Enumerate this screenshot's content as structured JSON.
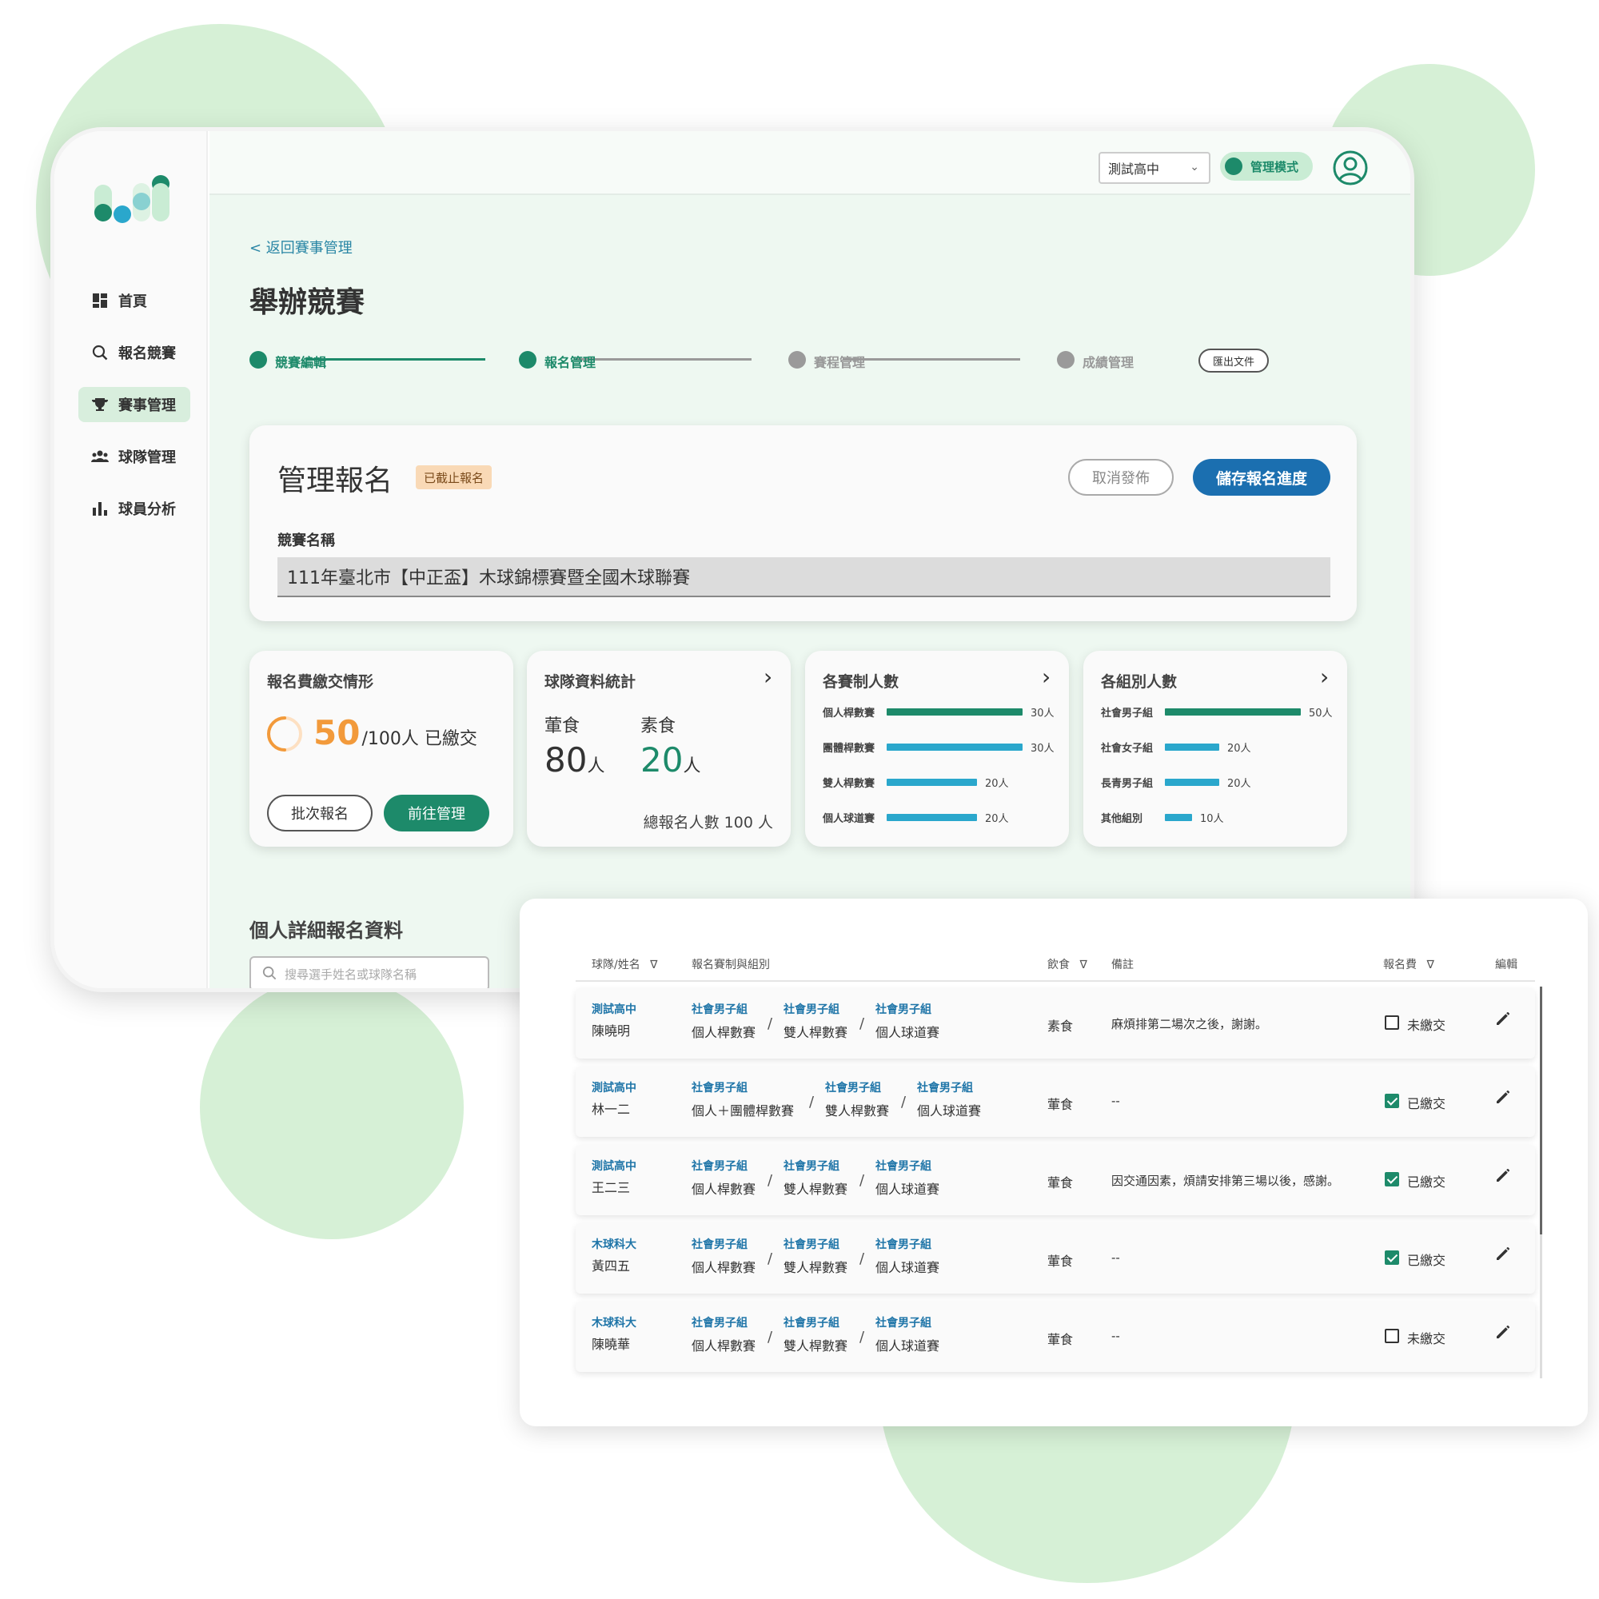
{
  "school_select": "測試高中",
  "mode_label": "管理模式",
  "sidebar": {
    "items": [
      {
        "label": "首頁",
        "icon": "dashboard-icon"
      },
      {
        "label": "報名競賽",
        "icon": "search-icon"
      },
      {
        "label": "賽事管理",
        "icon": "trophy-icon"
      },
      {
        "label": "球隊管理",
        "icon": "team-icon"
      },
      {
        "label": "球員分析",
        "icon": "bar-chart-icon"
      }
    ],
    "active_index": 2
  },
  "back_link": "< 返回賽事管理",
  "page_title": "舉辦競賽",
  "steps": [
    {
      "label": "競賽編輯",
      "done": true
    },
    {
      "label": "報名管理",
      "done": true
    },
    {
      "label": "賽程管理",
      "done": false
    },
    {
      "label": "成績管理",
      "done": false
    }
  ],
  "export_label": "匯出文件",
  "manage": {
    "title": "管理報名",
    "status_badge": "已截止報名",
    "cancel_label": "取消發佈",
    "save_label": "儲存報名進度",
    "field_label": "競賽名稱",
    "field_value": "111年臺北市【中正盃】木球錦標賽暨全國木球聯賽"
  },
  "fee_card": {
    "title": "報名費繳交情形",
    "paid": "50",
    "total_text": "/100人 已繳交",
    "paid_fraction": 0.5,
    "batch_label": "批次報名",
    "manage_label": "前往管理"
  },
  "team_card": {
    "title": "球隊資料統計",
    "meat_label": "葷食",
    "meat_value": "80",
    "veg_label": "素食",
    "veg_value": "20",
    "unit": "人",
    "total": "總報名人數 100 人"
  },
  "event_card": {
    "title": "各賽制人數",
    "rows": [
      {
        "label": "個人桿數賽",
        "value": 30,
        "text": "30人",
        "color": "#1d8a6a"
      },
      {
        "label": "團體桿數賽",
        "value": 30,
        "text": "30人",
        "color": "#2aa7cc"
      },
      {
        "label": "雙人桿數賽",
        "value": 20,
        "text": "20人",
        "color": "#2aa7cc"
      },
      {
        "label": "個人球道賽",
        "value": 20,
        "text": "20人",
        "color": "#2aa7cc"
      }
    ]
  },
  "group_card": {
    "title": "各組別人數",
    "rows": [
      {
        "label": "社會男子組",
        "value": 50,
        "text": "50人",
        "color": "#1d8a6a"
      },
      {
        "label": "社會女子組",
        "value": 20,
        "text": "20人",
        "color": "#2aa7cc"
      },
      {
        "label": "長青男子組",
        "value": 20,
        "text": "20人",
        "color": "#2aa7cc"
      },
      {
        "label": "其他組別",
        "value": 10,
        "text": "10人",
        "color": "#2aa7cc"
      }
    ]
  },
  "detail_section_title": "個人詳細報名資料",
  "search_placeholder": "搜尋選手姓名或球隊名稱",
  "table": {
    "headers": {
      "name": "球隊/姓名",
      "events": "報名賽制與組別",
      "diet": "飲食",
      "note": "備註",
      "fee": "報名費",
      "edit": "編輯"
    },
    "rows": [
      {
        "team": "測試高中",
        "name": "陳曉明",
        "events": [
          {
            "group": "社會男子組",
            "event": "個人桿數賽"
          },
          {
            "group": "社會男子組",
            "event": "雙人桿數賽"
          },
          {
            "group": "社會男子組",
            "event": "個人球道賽"
          }
        ],
        "diet": "素食",
        "note": "麻煩排第二場次之後，謝謝。",
        "paid": false,
        "fee": "未繳交"
      },
      {
        "team": "測試高中",
        "name": "林一二",
        "events": [
          {
            "group": "社會男子組",
            "event": "個人＋團體桿數賽"
          },
          {
            "group": "社會男子組",
            "event": "雙人桿數賽"
          },
          {
            "group": "社會男子組",
            "event": "個人球道賽"
          }
        ],
        "diet": "葷食",
        "note": "--",
        "paid": true,
        "fee": "已繳交"
      },
      {
        "team": "測試高中",
        "name": "王二三",
        "events": [
          {
            "group": "社會男子組",
            "event": "個人桿數賽"
          },
          {
            "group": "社會男子組",
            "event": "雙人桿數賽"
          },
          {
            "group": "社會男子組",
            "event": "個人球道賽"
          }
        ],
        "diet": "葷食",
        "note": "因交通因素，煩請安排第三場以後，感謝。",
        "paid": true,
        "fee": "已繳交"
      },
      {
        "team": "木球科大",
        "name": "黃四五",
        "events": [
          {
            "group": "社會男子組",
            "event": "個人桿數賽"
          },
          {
            "group": "社會男子組",
            "event": "雙人桿數賽"
          },
          {
            "group": "社會男子組",
            "event": "個人球道賽"
          }
        ],
        "diet": "葷食",
        "note": "--",
        "paid": true,
        "fee": "已繳交"
      },
      {
        "team": "木球科大",
        "name": "陳曉華",
        "events": [
          {
            "group": "社會男子組",
            "event": "個人桿數賽"
          },
          {
            "group": "社會男子組",
            "event": "雙人桿數賽"
          },
          {
            "group": "社會男子組",
            "event": "個人球道賽"
          }
        ],
        "diet": "葷食",
        "note": "--",
        "paid": false,
        "fee": "未繳交"
      }
    ]
  },
  "colors": {
    "accent": "#1d8a6a",
    "blue": "#1b6fb0",
    "link": "#1f75a8",
    "badge": "#f9d9b6",
    "ring": "#f29a3b"
  }
}
